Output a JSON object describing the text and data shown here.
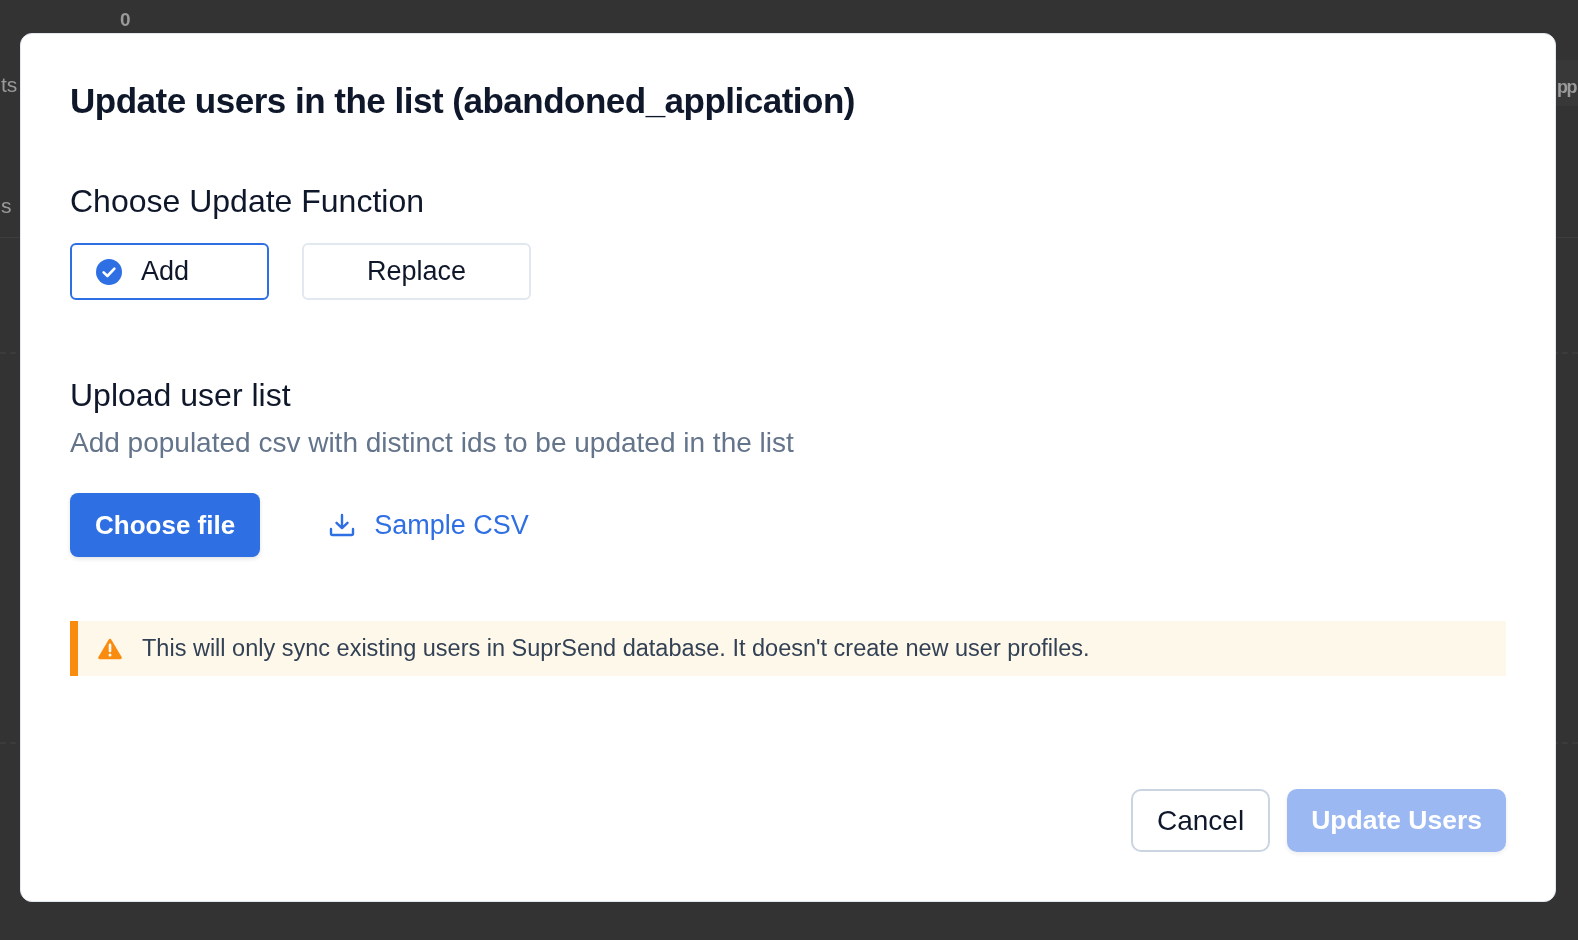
{
  "background": {
    "fragments": [
      "0",
      "ts",
      "s",
      "pp"
    ]
  },
  "dialog": {
    "title": "Update users in the list (abandoned_application)",
    "update_function": {
      "heading": "Choose Update Function",
      "options": [
        {
          "label": "Add",
          "selected": true
        },
        {
          "label": "Replace",
          "selected": false
        }
      ]
    },
    "upload": {
      "heading": "Upload user list",
      "description": "Add populated csv with distinct ids to be updated in the list",
      "choose_button": "Choose file",
      "sample_link": "Sample CSV"
    },
    "notice": {
      "kind": "warning",
      "text": "This will only sync existing users in SuprSend database. It doesn't create new user profiles."
    },
    "buttons": [
      {
        "label": "Cancel",
        "kind": "secondary",
        "disabled": false
      },
      {
        "label": "Update Users",
        "kind": "primary",
        "disabled": true
      }
    ]
  }
}
